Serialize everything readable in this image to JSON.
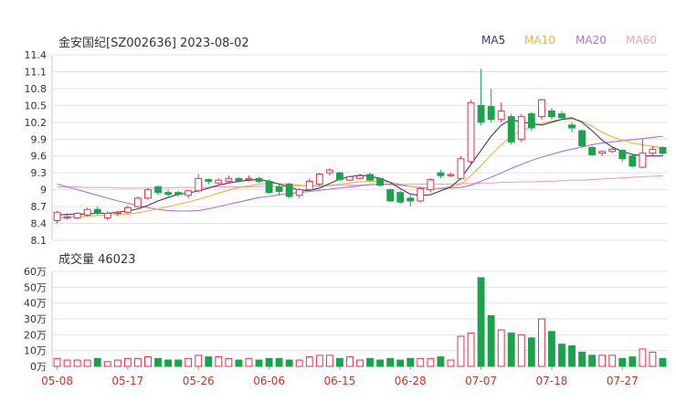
{
  "header": {
    "title": "金安国纪[SZ002636] 2023-08-02",
    "legend": [
      {
        "label": "MA5",
        "color": "#3a3a6a"
      },
      {
        "label": "MA10",
        "color": "#f0b040"
      },
      {
        "label": "MA20",
        "color": "#b070d8"
      },
      {
        "label": "MA60",
        "color": "#f0a0c8"
      }
    ],
    "volume_label": "成交量 46023"
  },
  "colors": {
    "up": "#e0314d",
    "down": "#1aa34a",
    "grid": "#e3e3e3",
    "axis_text": "#333333",
    "date_text": "#c0392b"
  },
  "chart_data": [
    {
      "type": "candlestick",
      "ylim": [
        8.1,
        11.4
      ],
      "yticks": [
        "8.1",
        "8.4",
        "8.7",
        "9",
        "9.3",
        "9.6",
        "9.9",
        "10.2",
        "10.5",
        "10.8",
        "11.1",
        "11.4"
      ],
      "xtick_labels": [
        "05-08",
        "05-17",
        "05-26",
        "06-06",
        "06-15",
        "06-28",
        "07-07",
        "07-18",
        "07-27"
      ],
      "xtick_index": [
        0,
        7,
        14,
        21,
        28,
        35,
        42,
        49,
        56
      ],
      "candles": [
        [
          8.45,
          8.6,
          8.62,
          8.4
        ],
        [
          8.5,
          8.52,
          8.58,
          8.47
        ],
        [
          8.5,
          8.58,
          8.6,
          8.48
        ],
        [
          8.55,
          8.65,
          8.68,
          8.52
        ],
        [
          8.65,
          8.58,
          8.7,
          8.55
        ],
        [
          8.5,
          8.58,
          8.62,
          8.45
        ],
        [
          8.58,
          8.6,
          8.63,
          8.53
        ],
        [
          8.6,
          8.68,
          8.72,
          8.57
        ],
        [
          8.7,
          8.85,
          8.88,
          8.68
        ],
        [
          8.85,
          9.0,
          9.03,
          8.82
        ],
        [
          9.05,
          8.95,
          9.08,
          8.9
        ],
        [
          8.95,
          8.92,
          9.0,
          8.88
        ],
        [
          8.95,
          8.92,
          8.98,
          8.88
        ],
        [
          8.9,
          8.98,
          9.0,
          8.85
        ],
        [
          8.98,
          9.2,
          9.28,
          8.95
        ],
        [
          9.18,
          9.15,
          9.2,
          9.1
        ],
        [
          9.12,
          9.17,
          9.2,
          9.1
        ],
        [
          9.15,
          9.2,
          9.25,
          9.12
        ],
        [
          9.2,
          9.16,
          9.22,
          9.12
        ],
        [
          9.18,
          9.2,
          9.25,
          9.15
        ],
        [
          9.2,
          9.15,
          9.23,
          9.12
        ],
        [
          9.15,
          8.95,
          9.18,
          8.93
        ],
        [
          9.05,
          8.97,
          9.1,
          8.9
        ],
        [
          9.1,
          8.88,
          9.12,
          8.85
        ],
        [
          8.9,
          9.0,
          9.03,
          8.85
        ],
        [
          9.0,
          9.15,
          9.2,
          8.98
        ],
        [
          9.1,
          9.28,
          9.3,
          9.05
        ],
        [
          9.3,
          9.35,
          9.38,
          9.25
        ],
        [
          9.3,
          9.18,
          9.32,
          9.15
        ],
        [
          9.17,
          9.23,
          9.25,
          9.15
        ],
        [
          9.2,
          9.25,
          9.28,
          9.18
        ],
        [
          9.27,
          9.17,
          9.3,
          9.15
        ],
        [
          9.2,
          9.08,
          9.22,
          9.05
        ],
        [
          9.0,
          8.8,
          9.02,
          8.78
        ],
        [
          8.95,
          8.78,
          8.98,
          8.75
        ],
        [
          8.85,
          8.8,
          8.9,
          8.7
        ],
        [
          8.8,
          9.02,
          9.05,
          8.78
        ],
        [
          9.0,
          9.18,
          9.2,
          8.95
        ],
        [
          9.3,
          9.25,
          9.35,
          9.2
        ],
        [
          9.25,
          9.27,
          9.3,
          9.23
        ],
        [
          9.2,
          9.55,
          9.6,
          9.18
        ],
        [
          9.5,
          10.55,
          10.6,
          9.45
        ],
        [
          10.5,
          10.2,
          11.15,
          10.15
        ],
        [
          10.48,
          10.25,
          10.8,
          10.2
        ],
        [
          10.25,
          10.4,
          10.55,
          10.2
        ],
        [
          10.3,
          9.85,
          10.35,
          9.8
        ],
        [
          9.9,
          10.3,
          10.35,
          9.85
        ],
        [
          10.35,
          10.1,
          10.38,
          10.05
        ],
        [
          10.3,
          10.6,
          10.62,
          10.25
        ],
        [
          10.4,
          10.3,
          10.45,
          10.25
        ],
        [
          10.35,
          10.28,
          10.4,
          10.25
        ],
        [
          10.15,
          10.1,
          10.2,
          10.02
        ],
        [
          10.05,
          9.78,
          10.07,
          9.75
        ],
        [
          9.75,
          9.62,
          9.78,
          9.6
        ],
        [
          9.65,
          9.68,
          9.7,
          9.6
        ],
        [
          9.68,
          9.72,
          9.75,
          9.65
        ],
        [
          9.7,
          9.55,
          9.72,
          9.5
        ],
        [
          9.6,
          9.42,
          9.62,
          9.4
        ],
        [
          9.4,
          9.65,
          9.9,
          9.38
        ],
        [
          9.65,
          9.72,
          9.78,
          9.6
        ],
        [
          9.75,
          9.65,
          9.77,
          9.62
        ]
      ],
      "ma5": [
        8.55,
        8.56,
        8.56,
        8.57,
        8.58,
        8.58,
        8.6,
        8.62,
        8.66,
        8.72,
        8.8,
        8.86,
        8.92,
        8.94,
        8.98,
        9.03,
        9.08,
        9.12,
        9.15,
        9.17,
        9.18,
        9.15,
        9.1,
        9.05,
        8.99,
        8.99,
        9.03,
        9.11,
        9.19,
        9.23,
        9.26,
        9.24,
        9.2,
        9.13,
        9.02,
        8.92,
        8.9,
        8.91,
        8.98,
        9.05,
        9.2,
        9.45,
        9.7,
        9.95,
        10.15,
        10.25,
        10.2,
        10.18,
        10.15,
        10.2,
        10.25,
        10.28,
        10.2,
        10.05,
        9.88,
        9.76,
        9.68,
        9.63,
        9.6,
        9.6,
        9.6
      ],
      "ma10": [
        8.5,
        8.51,
        8.52,
        8.53,
        8.54,
        8.55,
        8.56,
        8.57,
        8.59,
        8.62,
        8.66,
        8.7,
        8.74,
        8.78,
        8.83,
        8.88,
        8.94,
        8.99,
        9.04,
        9.07,
        9.1,
        9.11,
        9.11,
        9.1,
        9.08,
        9.07,
        9.07,
        9.08,
        9.1,
        9.12,
        9.14,
        9.15,
        9.15,
        9.13,
        9.1,
        9.06,
        9.03,
        9.02,
        9.03,
        9.05,
        9.1,
        9.25,
        9.43,
        9.62,
        9.8,
        9.95,
        10.05,
        10.12,
        10.18,
        10.22,
        10.25,
        10.26,
        10.22,
        10.13,
        10.02,
        9.94,
        9.88,
        9.83,
        9.8,
        9.77,
        9.75
      ],
      "ma20": [
        9.1,
        9.05,
        9.0,
        8.95,
        8.9,
        8.85,
        8.8,
        8.76,
        8.72,
        8.68,
        8.65,
        8.63,
        8.62,
        8.62,
        8.63,
        8.66,
        8.7,
        8.74,
        8.78,
        8.82,
        8.86,
        8.88,
        8.91,
        8.93,
        8.95,
        8.97,
        8.99,
        9.01,
        9.03,
        9.05,
        9.07,
        9.09,
        9.1,
        9.1,
        9.08,
        9.06,
        9.04,
        9.03,
        9.02,
        9.03,
        9.04,
        9.08,
        9.15,
        9.22,
        9.3,
        9.38,
        9.45,
        9.52,
        9.58,
        9.63,
        9.68,
        9.72,
        9.76,
        9.8,
        9.83,
        9.85,
        9.87,
        9.89,
        9.91,
        9.93,
        9.95
      ],
      "ma60": [
        9.05,
        9.05,
        9.05,
        9.04,
        9.04,
        9.04,
        9.03,
        9.03,
        9.03,
        9.03,
        9.03,
        9.03,
        9.04,
        9.04,
        9.04,
        9.04,
        9.05,
        9.05,
        9.05,
        9.05,
        9.06,
        9.06,
        9.06,
        9.06,
        9.07,
        9.07,
        9.07,
        9.07,
        9.08,
        9.08,
        9.08,
        9.09,
        9.09,
        9.09,
        9.09,
        9.1,
        9.1,
        9.1,
        9.1,
        9.1,
        9.11,
        9.11,
        9.12,
        9.12,
        9.13,
        9.13,
        9.14,
        9.14,
        9.15,
        9.15,
        9.16,
        9.17,
        9.17,
        9.18,
        9.19,
        9.2,
        9.21,
        9.22,
        9.23,
        9.24,
        9.25
      ]
    },
    {
      "type": "bar",
      "name": "volume",
      "ylim": [
        0,
        60
      ],
      "yticks": [
        "0万",
        "10万",
        "20万",
        "30万",
        "40万",
        "50万",
        "60万"
      ],
      "values": [
        5,
        4,
        4,
        4,
        5,
        3,
        4,
        5,
        5,
        6,
        5,
        4,
        4,
        5,
        7,
        6,
        6,
        5,
        4,
        5,
        4,
        5,
        5,
        4,
        4,
        6,
        7,
        7,
        5,
        6,
        4,
        5,
        4,
        5,
        4,
        5,
        5,
        5,
        6,
        4,
        19,
        21,
        56,
        32,
        23,
        21,
        20,
        18,
        30,
        22,
        14,
        13,
        9,
        7,
        7,
        7,
        5,
        6,
        11,
        9,
        5
      ]
    }
  ]
}
